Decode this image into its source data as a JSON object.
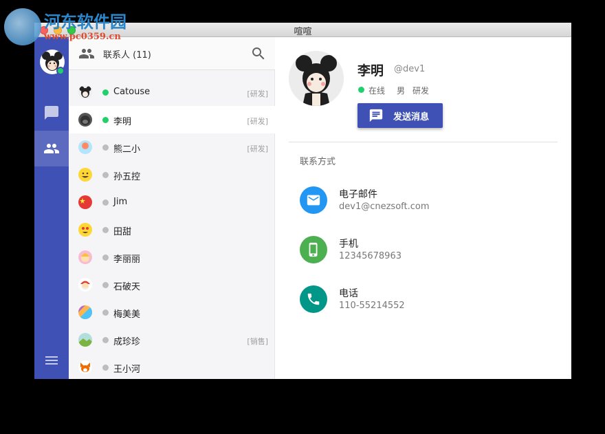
{
  "window": {
    "title": "喧喧"
  },
  "watermark": {
    "name": "河东软件园",
    "url": "www.pc0359.cn"
  },
  "rail": {
    "items": [
      {
        "icon": "chat-icon",
        "active": false
      },
      {
        "icon": "people-icon",
        "active": true
      }
    ],
    "menu_icon": "menu-icon"
  },
  "list": {
    "title": "联系人 (11)",
    "contacts": [
      {
        "name": "Catouse",
        "tag": "[研发]",
        "online": true,
        "avatar": "mickey"
      },
      {
        "name": "李明",
        "tag": "[研发]",
        "online": true,
        "avatar": "gorilla",
        "selected": true
      },
      {
        "name": "熊二小",
        "tag": "[研发]",
        "online": false,
        "avatar": "balloon"
      },
      {
        "name": "孙五控",
        "tag": "",
        "online": false,
        "avatar": "smile"
      },
      {
        "name": "Jim",
        "tag": "",
        "online": false,
        "avatar": "flag"
      },
      {
        "name": "田甜",
        "tag": "",
        "online": false,
        "avatar": "heart-eyes"
      },
      {
        "name": "李丽丽",
        "tag": "",
        "online": false,
        "avatar": "girl"
      },
      {
        "name": "石破天",
        "tag": "",
        "online": false,
        "avatar": "santa"
      },
      {
        "name": "梅美美",
        "tag": "",
        "online": false,
        "avatar": "colors"
      },
      {
        "name": "成珍珍",
        "tag": "[销售]",
        "online": false,
        "avatar": "landscape"
      },
      {
        "name": "王小河",
        "tag": "",
        "online": false,
        "avatar": "fox"
      }
    ]
  },
  "detail": {
    "name": "李明",
    "handle": "@dev1",
    "status": "在线",
    "gender": "男",
    "dept": "研发",
    "send_label": "发送消息",
    "section_title": "联系方式",
    "methods": [
      {
        "label": "电子邮件",
        "value": "dev1@cnezsoft.com",
        "color": "#2196f3",
        "icon": "email-icon"
      },
      {
        "label": "手机",
        "value": "12345678963",
        "color": "#4caf50",
        "icon": "mobile-icon"
      },
      {
        "label": "电话",
        "value": "110-55214552",
        "color": "#009688",
        "icon": "phone-icon"
      }
    ]
  },
  "colors": {
    "accent": "#3f51b5",
    "online": "#22d06b",
    "offline": "#bdbdbd"
  }
}
